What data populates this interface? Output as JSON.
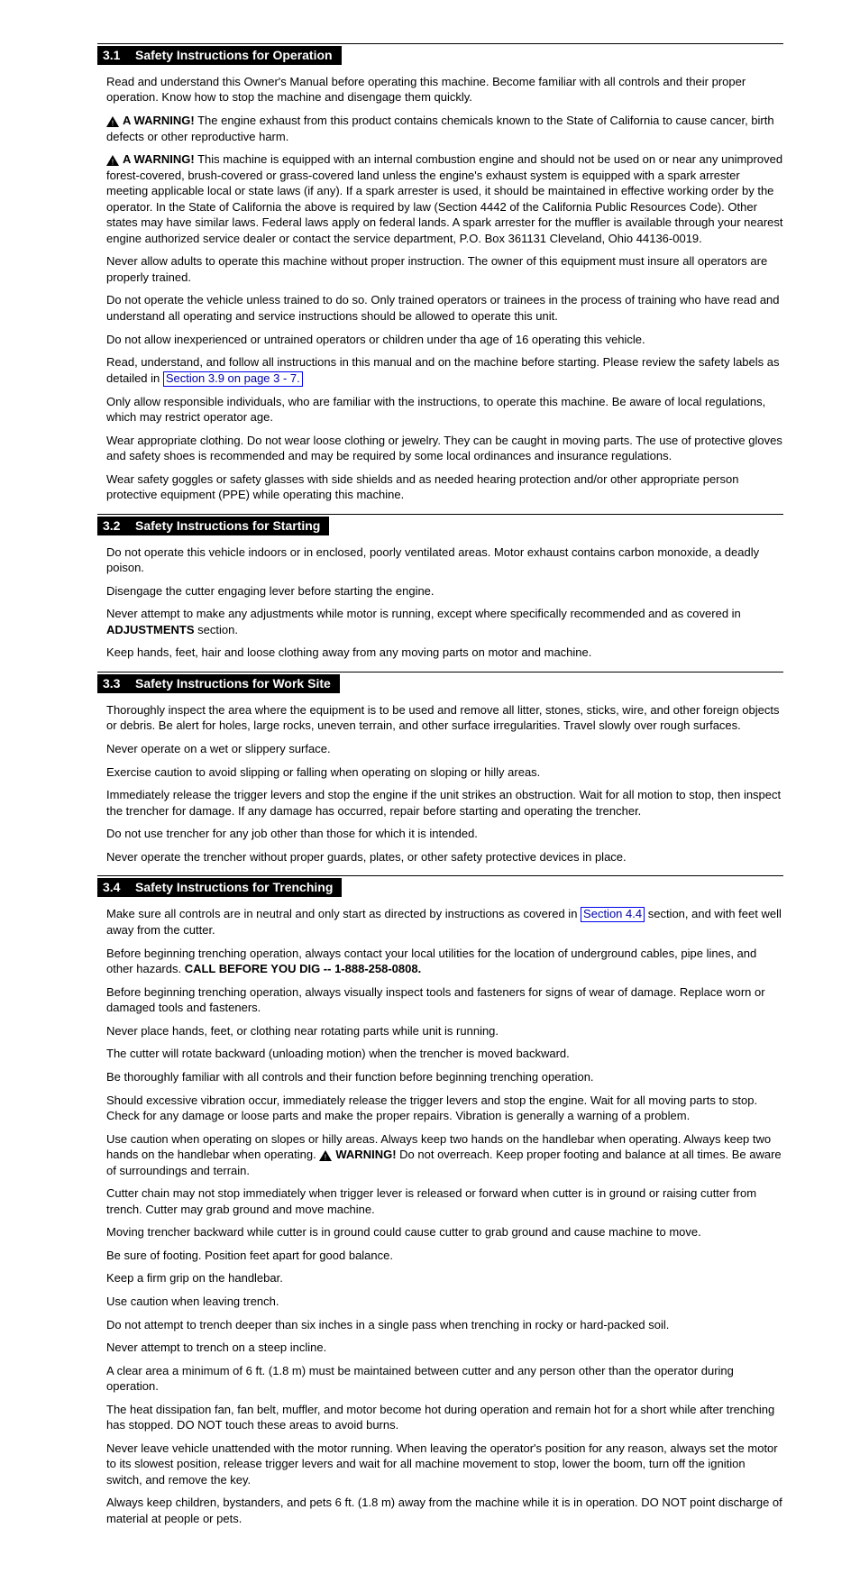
{
  "sections": [
    {
      "num": "3.1",
      "title": "Safety Instructions for Operation",
      "paras": {
        "intro": "Read and understand this Owner's Manual before operating this machine. Become familiar with all controls and their proper operation. Know how to stop the machine and disengage them quickly.",
        "w1_label": "A WARNING!",
        "w1_text": "The engine exhaust from this product contains chemicals known to the State of California to cause cancer, birth defects or other reproductive harm.",
        "w2_label": "A WARNING!",
        "w2_text": "This machine is equipped with an internal combustion engine and should not be used on or near any unimproved forest-covered, brush-covered or grass-covered land unless the engine's exhaust system is equipped with a spark arrester meeting applicable local or state laws (if any). If a spark arrester is used, it should be maintained in effective working order by the operator. In the State of California the above is required by law (Section 4442 of the California Public Resources Code). Other states may have similar laws. Federal laws apply on federal lands. A spark arrester for the muffler is available through your nearest engine authorized service dealer or contact the service department, P.O. Box 361131 Cleveland, Ohio 44136-0019.",
        "bullets_intro": "Never allow adults to operate this machine without proper instruction. The owner of this equipment must insure all operators are properly trained.",
        "b1": "Do not operate the vehicle unless trained to do so. Only trained operators or trainees in the process of training who have read and understand all operating and service instructions should be allowed to operate this unit.",
        "b2": "Do not allow inexperienced or untrained operators or children under tha age of 16 operating this vehicle.",
        "b3_pre": "Read, understand, and follow all instructions in this manual and on the machine before starting. Please review the safety labels as detailed in ",
        "b3_link": "Section 3.9 on page 3 - 7.",
        "b4": "Only allow responsible individuals, who are familiar with the instructions, to operate this machine. Be aware of local regulations, which may restrict operator age.",
        "b5": "Wear appropriate clothing. Do not wear loose clothing or jewelry. They can be caught in moving parts. The use of protective gloves and safety shoes is recommended and may be required by some local ordinances and insurance regulations.",
        "b6": "Wear safety goggles or safety glasses with side shields and as needed hearing protection and/or other appropriate person protective equipment (PPE) while operating this machine."
      }
    },
    {
      "num": "3.2",
      "title": "Safety Instructions for Starting",
      "paras": {
        "b1": "Do not operate this vehicle indoors or in enclosed, poorly ventilated areas. Motor exhaust contains carbon monoxide, a deadly poison.",
        "b2": "Disengage the cutter engaging lever before starting the engine.",
        "b3_pre": "Never attempt to make any adjustments while motor is running, except where specifically recommended and as covered in ",
        "b3_link": "ADJUSTMENTS",
        "b3_post": " section.",
        "b4": "Keep hands, feet, hair and loose clothing away from any moving parts on motor and machine."
      }
    },
    {
      "num": "3.3",
      "title": "Safety Instructions for Work Site",
      "paras": {
        "b1": "Thoroughly inspect the area where the equipment is to be used and remove all litter, stones, sticks, wire, and other foreign objects or debris. Be alert for holes, large rocks, uneven terrain, and other surface irregularities. Travel slowly over rough surfaces.",
        "b2": "Never operate on a wet or slippery surface.",
        "b3": "Exercise caution to avoid slipping or falling when operating on sloping or hilly areas.",
        "b4": "Immediately release the trigger levers and stop the engine if the unit strikes an obstruction. Wait for all motion to stop, then inspect the trencher for damage. If any damage has occurred, repair before starting and operating the trencher.",
        "b5": "Do not use trencher for any job other than those for which it is intended.",
        "b6": "Never operate the trencher without proper guards, plates, or other safety protective devices in place."
      }
    },
    {
      "num": "3.4",
      "title": "Safety Instructions for Trenching",
      "paras": {
        "b1_pre": "Make sure all controls are in neutral and only start as directed by instructions as covered in ",
        "b1_link": "Section 4.4",
        "b1_post": " section, and with feet well away from the cutter.",
        "b2_pre": "Before beginning trenching operation, always contact your local utilities for the location of underground cables, pipe lines, and other hazards. ",
        "b2_bold": "CALL BEFORE YOU DIG -- 1-888-258-0808.",
        "b3": "Before beginning trenching operation, always visually inspect tools and fasteners for signs of wear of damage. Replace worn or damaged tools and fasteners.",
        "b4": "Never place hands, feet, or clothing near rotating parts while unit is running.",
        "b5": "The cutter will rotate backward (unloading motion) when the trencher is moved backward.",
        "b6": "Be thoroughly familiar with all controls and their function before beginning trenching operation.",
        "b7": "Should excessive vibration occur, immediately release the trigger levers and stop the engine. Wait for all moving parts to stop. Check for any damage or loose parts and make the proper repairs. Vibration is generally a warning of a problem.",
        "b8_pre": "Use caution when operating on slopes or hilly areas. Always keep two hands on the handlebar when operating. Always keep two hands on the handlebar when operating. ",
        "b8_w_label": "WARNING!",
        "b8_w_text": "Do not overreach. Keep proper footing and balance at all times. Be aware of surroundings and terrain.",
        "b9": "Cutter chain may not stop immediately when trigger lever is released or forward when cutter is in ground or raising cutter from trench. Cutter may grab ground and move machine.",
        "b10": "Moving trencher backward while cutter is in ground could cause cutter to grab ground and cause machine to move.",
        "b11": "Be sure of footing. Position feet apart for good balance.",
        "b12": "Keep a firm grip on the handlebar.",
        "b13": "Use caution when leaving trench.",
        "b14": "Do not attempt to trench deeper than six inches in a single pass when trenching in rocky or hard-packed soil.",
        "b15": "Never attempt to trench on a steep incline.",
        "b16": "A clear area a minimum of 6 ft. (1.8 m) must be maintained between cutter and any person other than the operator during operation.",
        "b17": "The heat dissipation fan, fan belt, muffler, and motor become hot during operation and remain hot for a short while after trenching has stopped. DO NOT touch these areas to avoid burns.",
        "b18": "Never leave vehicle unattended with the motor running. When leaving the operator's position for any reason, always set the motor to its slowest position, release trigger levers and wait for all machine movement to stop, lower the boom, turn off the ignition switch, and remove the key.",
        "b19": "Always keep children, bystanders, and pets 6 ft. (1.8 m) away from the machine while it is in operation. DO NOT point discharge of material at people or pets."
      }
    }
  ]
}
